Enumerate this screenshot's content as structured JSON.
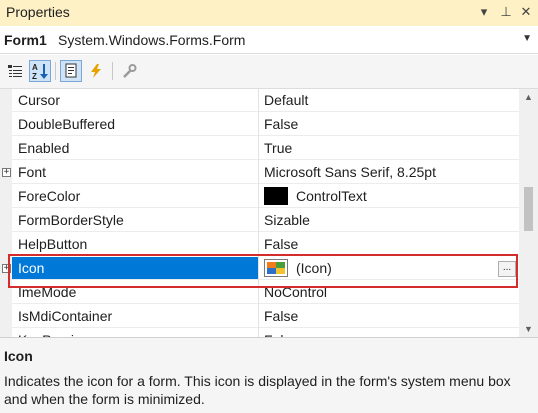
{
  "window": {
    "title": "Properties"
  },
  "object_selector": {
    "name": "Form1",
    "type": "System.Windows.Forms.Form"
  },
  "toolbar": {
    "buttons": [
      {
        "icon": "categorized-icon",
        "pressed": false
      },
      {
        "icon": "alphabetical-sort-icon",
        "pressed": true
      },
      {
        "icon": "properties-icon",
        "pressed": true
      },
      {
        "icon": "events-lightning-icon",
        "pressed": false
      },
      {
        "icon": "property-pages-wrench-icon",
        "pressed": false
      }
    ]
  },
  "grid": {
    "rows": [
      {
        "name": "Cursor",
        "value": "Default"
      },
      {
        "name": "DoubleBuffered",
        "value": "False"
      },
      {
        "name": "Enabled",
        "value": "True"
      },
      {
        "name": "Font",
        "value": "Microsoft Sans Serif, 8.25pt",
        "expandable": true
      },
      {
        "name": "ForeColor",
        "value": "ControlText",
        "swatch": "#000000"
      },
      {
        "name": "FormBorderStyle",
        "value": "Sizable"
      },
      {
        "name": "HelpButton",
        "value": "False"
      },
      {
        "name": "Icon",
        "value": "(Icon)",
        "expandable": true,
        "selected": true,
        "has_icon": true,
        "ellipsis": "..."
      },
      {
        "name": "ImeMode",
        "value": "NoControl"
      },
      {
        "name": "IsMdiContainer",
        "value": "False"
      },
      {
        "name": "KeyPreview",
        "value": "False"
      }
    ]
  },
  "description": {
    "title": "Icon",
    "text": "Indicates the icon for a form. This icon is displayed in the form's system menu box and when the form is minimized."
  },
  "colors": {
    "selection": "#0078d7",
    "title_bar": "#fff1c6",
    "highlight_border": "#d42b2b"
  }
}
